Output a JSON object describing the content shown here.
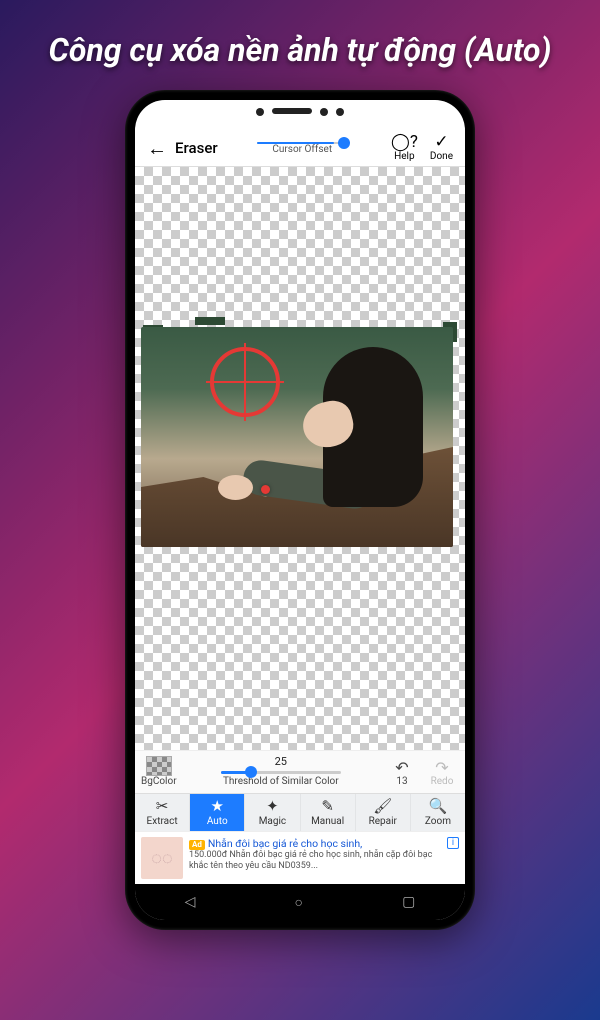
{
  "promo_title": "Công cụ xóa nền ảnh tự động (Auto)",
  "topbar": {
    "title": "Eraser",
    "cursor_offset_label": "Cursor Offset",
    "help_label": "Help",
    "done_label": "Done"
  },
  "threshold_row": {
    "bgcolor_label": "BgColor",
    "threshold_value": "25",
    "threshold_label": "Threshold of Similar Color",
    "undo_count": "13",
    "redo_label": "Redo"
  },
  "tools": {
    "extract": "Extract",
    "auto": "Auto",
    "magic": "Magic",
    "manual": "Manual",
    "repair": "Repair",
    "zoom": "Zoom"
  },
  "ad": {
    "badge": "Ad",
    "title": "Nhẫn đôi bạc giá rẻ cho học sinh,",
    "desc": "150.000đ Nhẫn đôi bạc giá rẻ cho học sinh, nhẫn cặp đôi bạc khắc tên theo yêu cầu ND0359...",
    "info": "i"
  },
  "colors": {
    "accent": "#1d7cff",
    "crosshair": "#e53935"
  }
}
